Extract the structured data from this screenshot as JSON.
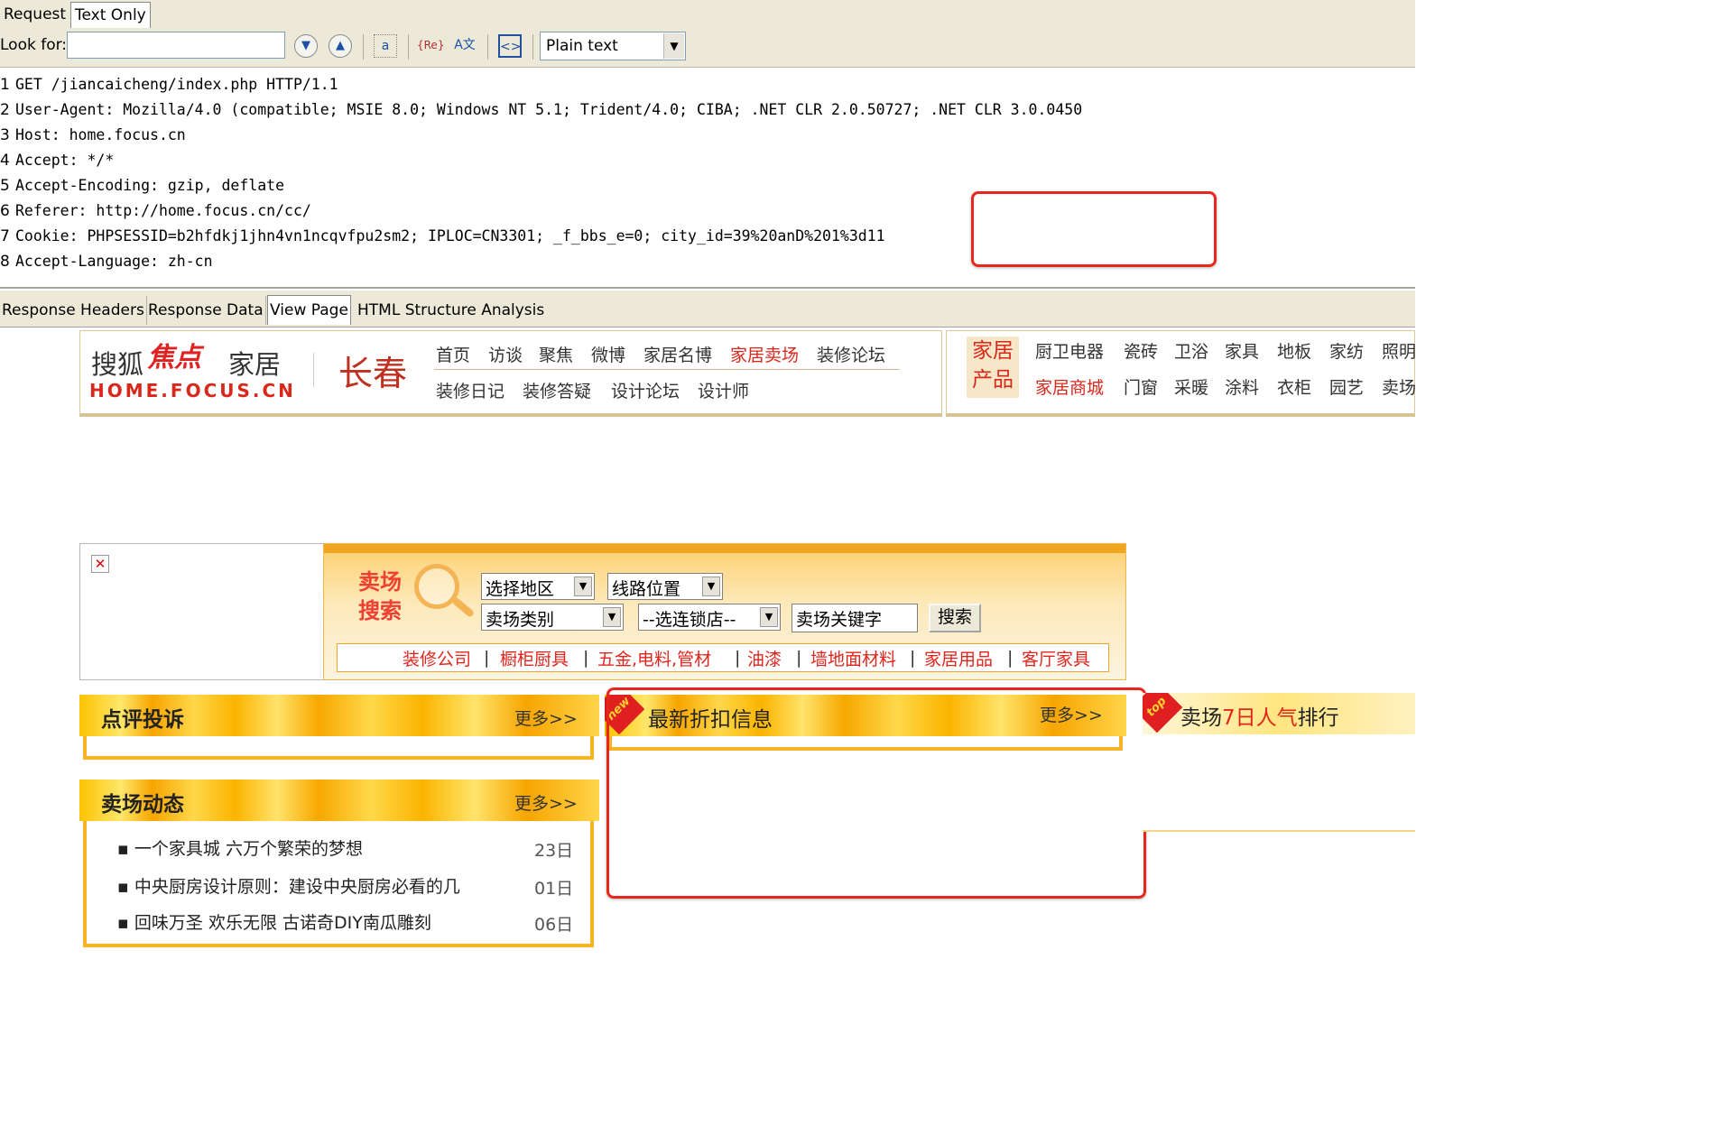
{
  "request_tabs": [
    {
      "label": "Request"
    },
    {
      "label": "Text Only"
    }
  ],
  "toolbar": {
    "look_for_label": "Look for:",
    "search_value": "",
    "find_down_icon": "chevron-down-icon",
    "find_up_icon": "chevron-up-icon",
    "mode_value": "Plain text"
  },
  "request_lines": [
    {
      "n": "1",
      "text": "GET /jiancaicheng/index.php HTTP/1.1"
    },
    {
      "n": "2",
      "text": "User-Agent: Mozilla/4.0 (compatible; MSIE 8.0; Windows NT 5.1; Trident/4.0; CIBA; .NET CLR 2.0.50727; .NET CLR 3.0.0450"
    },
    {
      "n": "3",
      "text": "Host: home.focus.cn"
    },
    {
      "n": "4",
      "text": "Accept: */*"
    },
    {
      "n": "5",
      "text": "Accept-Encoding: gzip, deflate"
    },
    {
      "n": "6",
      "text": "Referer: http://home.focus.cn/cc/"
    },
    {
      "n": "7",
      "text": "Cookie: PHPSESSID=b2hfdkj1jhn4vn1ncqvfpu2sm2; IPLOC=CN3301; _f_bbs_e=0; city_id=39%20anD%201%3d11"
    },
    {
      "n": "8",
      "text": "Accept-Language: zh-cn"
    }
  ],
  "response_tabs": [
    {
      "label": "Response Headers"
    },
    {
      "label": "Response Data"
    },
    {
      "label": "View Page"
    },
    {
      "label": "HTML Structure Analysis"
    }
  ],
  "site": {
    "logo_sohu": "搜狐",
    "logo_focus": "焦点",
    "logo_home": "家居",
    "logo_url": "HOME.FOCUS.CN",
    "city": "长春",
    "nav_row1": [
      "首页",
      "访谈",
      "聚焦",
      "微博",
      "家居名博",
      "家居卖场",
      "装修论坛"
    ],
    "nav_row2": [
      "装修日记",
      "装修答疑",
      "设计论坛",
      "设计师"
    ],
    "product_title": "家居产品",
    "product_row1": [
      "厨卫电器",
      "瓷砖",
      "卫浴",
      "家具",
      "地板",
      "家纺",
      "照明"
    ],
    "product_row2": [
      "家居商城",
      "门窗",
      "采暖",
      "涂料",
      "衣柜",
      "园艺",
      "卖场"
    ]
  },
  "market_search": {
    "title": "卖场搜索",
    "region": "选择地区",
    "line": "线路位置",
    "type": "卖场类别",
    "chain": "--选连锁店--",
    "keyword": "卖场关键字",
    "button": "搜索",
    "categories": [
      "装修公司",
      "橱柜厨具",
      "五金,电料,管材",
      "油漆",
      "墙地面材料",
      "家居用品",
      "客厅家具"
    ]
  },
  "sections": {
    "review": {
      "title": "点评投诉",
      "more": "更多>>"
    },
    "news": {
      "title": "卖场动态",
      "more": "更多>>",
      "items": [
        {
          "title": "一个家具城 六万个繁荣的梦想",
          "date": "23日"
        },
        {
          "title": "中央厨房设计原则：建设中央厨房必看的几",
          "date": "01日"
        },
        {
          "title": "回味万圣 欢乐无限 古诺奇DIY南瓜雕刻",
          "date": "06日"
        }
      ]
    },
    "discount": {
      "badge": "new",
      "title": "最新折扣信息",
      "more": "更多>>"
    },
    "ranking": {
      "badge": "top",
      "title_a": "卖场",
      "title_b": "7日",
      "title_c": "人气",
      "title_d": "排行"
    }
  },
  "colors": {
    "annotation": "#e8261c",
    "accent_red": "#d8281c",
    "panel_orange": "#f8b226"
  }
}
